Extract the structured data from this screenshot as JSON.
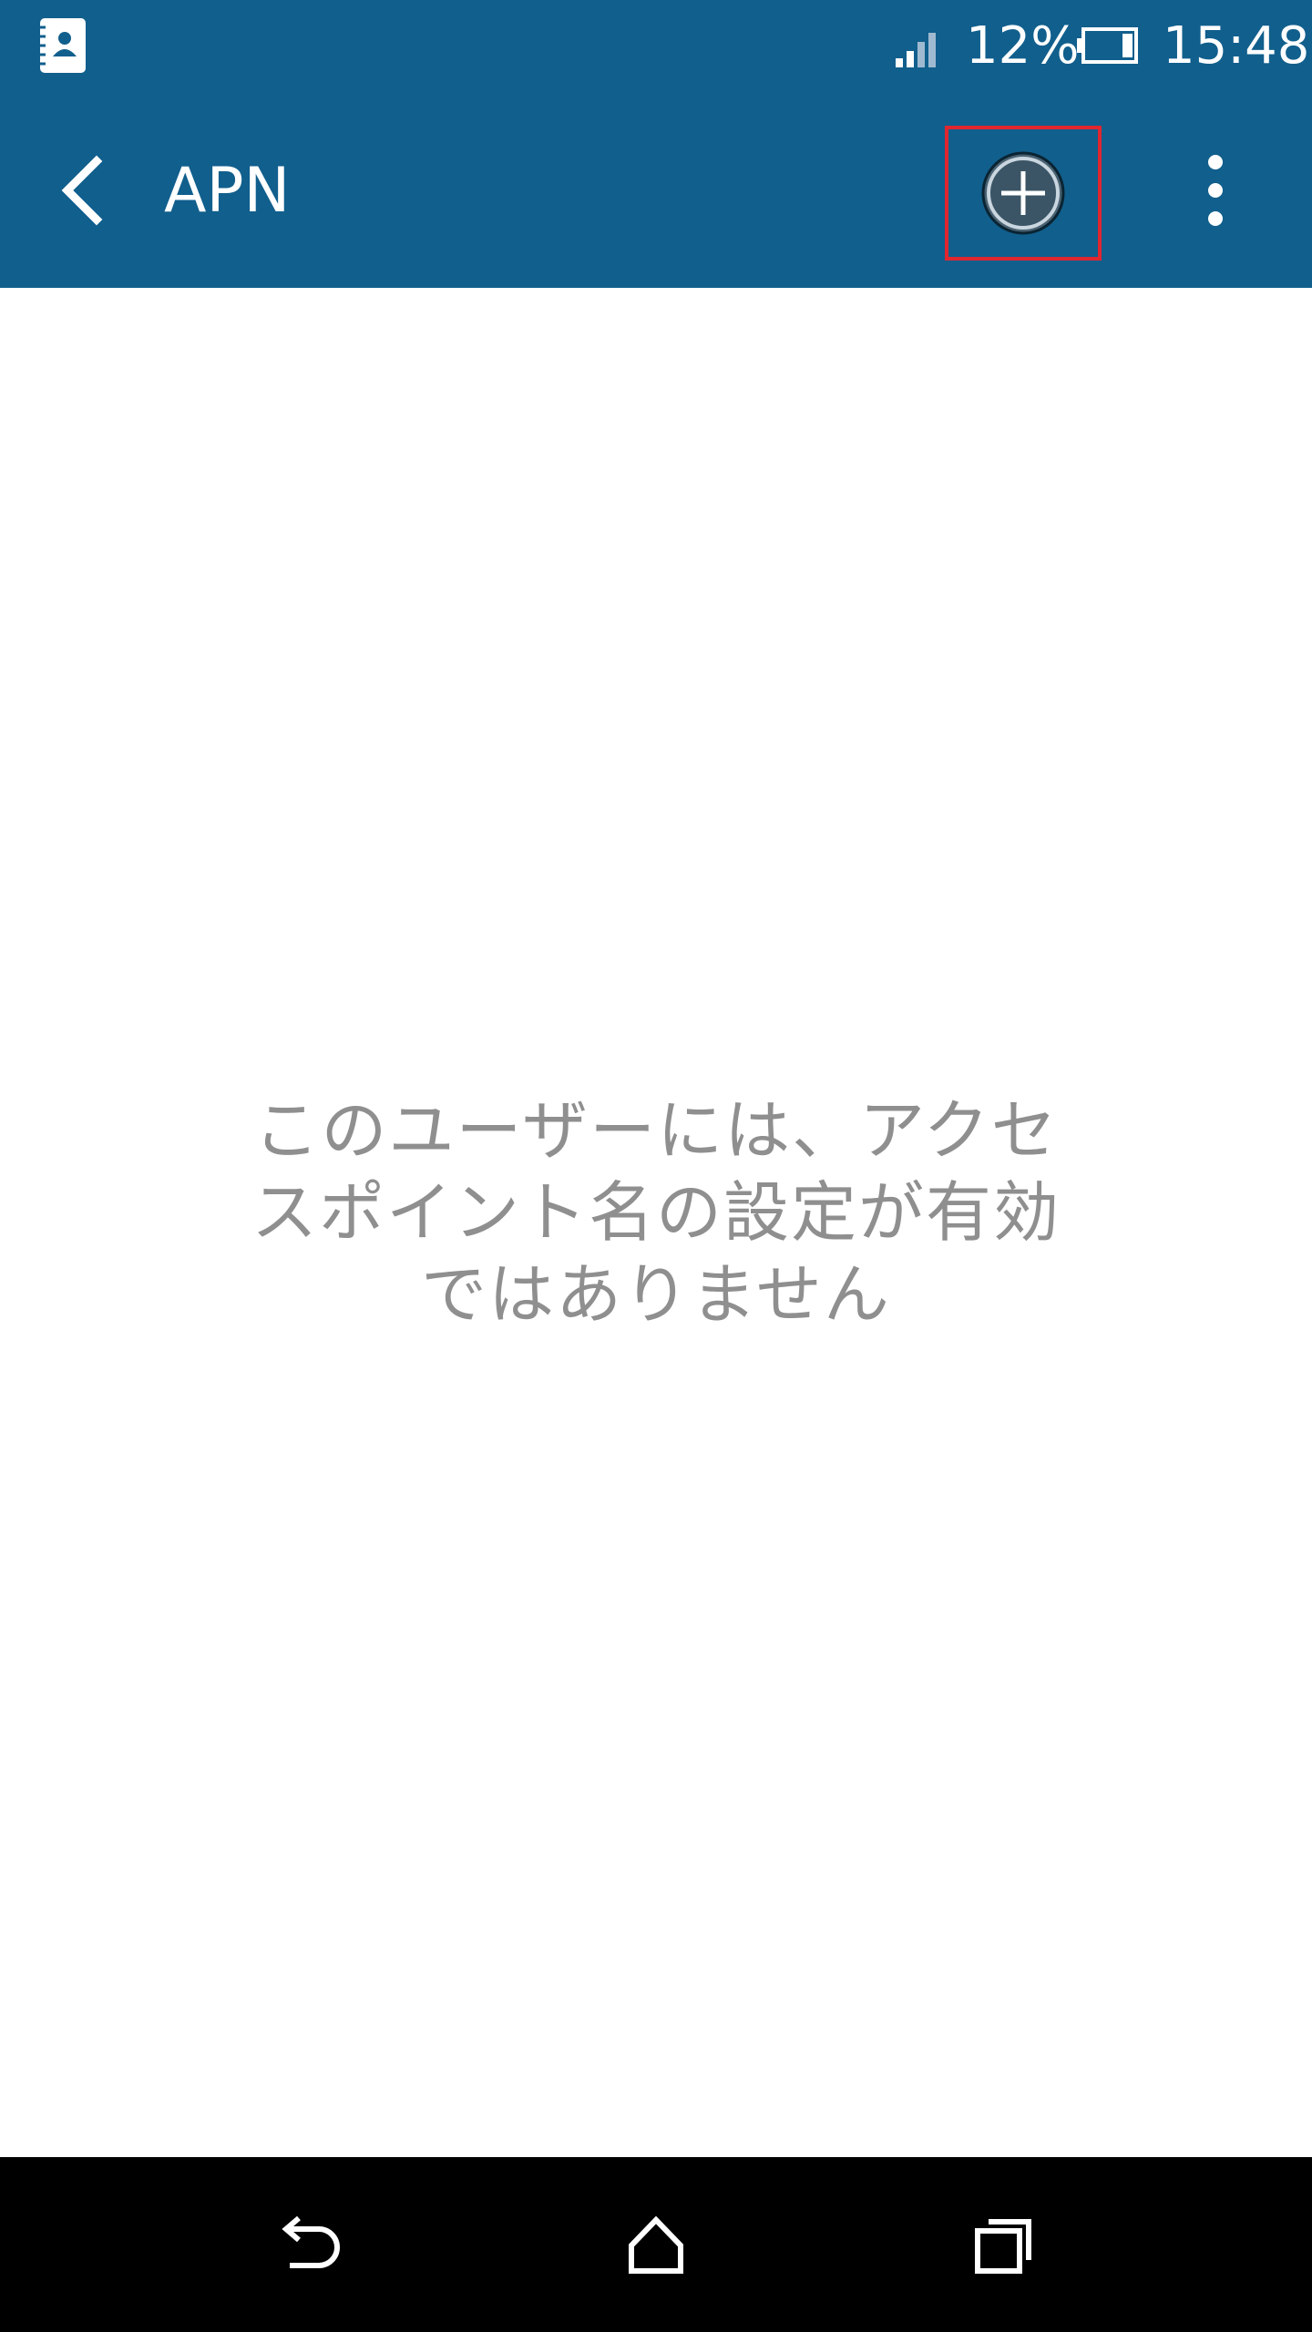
{
  "status_bar": {
    "notification_icon": "contacts-icon",
    "signal_icon": "cell-signal-icon",
    "battery_percent": "12%",
    "battery_icon": "battery-icon",
    "time": "15:48"
  },
  "app_bar": {
    "back_icon": "chevron-left-icon",
    "title": "APN",
    "add_icon": "add-circle-icon",
    "overflow_icon": "more-vertical-icon",
    "background_color": "#115f8d",
    "highlight_color": "#e0262f"
  },
  "content": {
    "empty_message_line1": "このユーザーには、アクセ",
    "empty_message_line2": "スポイント名の設定が有効",
    "empty_message_line3": "ではありません",
    "text_color": "#8f8f8f"
  },
  "nav_bar": {
    "back_icon": "back-arrow-icon",
    "home_icon": "home-icon",
    "recents_icon": "recents-icon"
  }
}
